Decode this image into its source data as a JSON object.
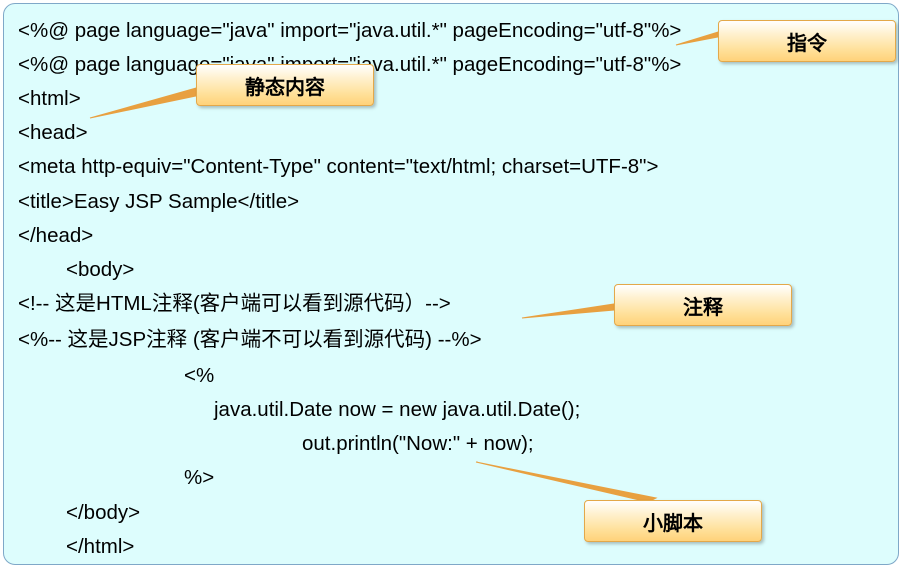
{
  "code_lines": [
    "<%@ page language=\"java\" import=\"java.util.*\" pageEncoding=\"utf-8\"%>",
    "<%@ page language=\"java\" import=\"java.util.*\" pageEncoding=\"utf-8\"%>",
    "<html>",
    "<head>",
    "<meta http-equiv=\"Content-Type\" content=\"text/html; charset=UTF-8\">",
    "<title>Easy JSP Sample</title>",
    "</head>",
    "<body>",
    "<!-- 这是HTML注释(客户端可以看到源代码）-->",
    "<%-- 这是JSP注释 (客户端不可以看到源代码) --%>",
    "<%",
    "java.util.Date now = new java.util.Date();",
    "out.println(\"Now:\" + now);",
    "%>",
    "</body>",
    "</html>"
  ],
  "callouts": {
    "directive": "指令",
    "static_content": "静态内容",
    "comment": "注释",
    "scriptlet": "小脚本"
  },
  "colors": {
    "panel_background": "#ddfdfd",
    "panel_border": "#7fa8c8",
    "callout_fill": "#ffdf96",
    "callout_border": "#e3a84a",
    "leader_line": "#e8a040"
  }
}
